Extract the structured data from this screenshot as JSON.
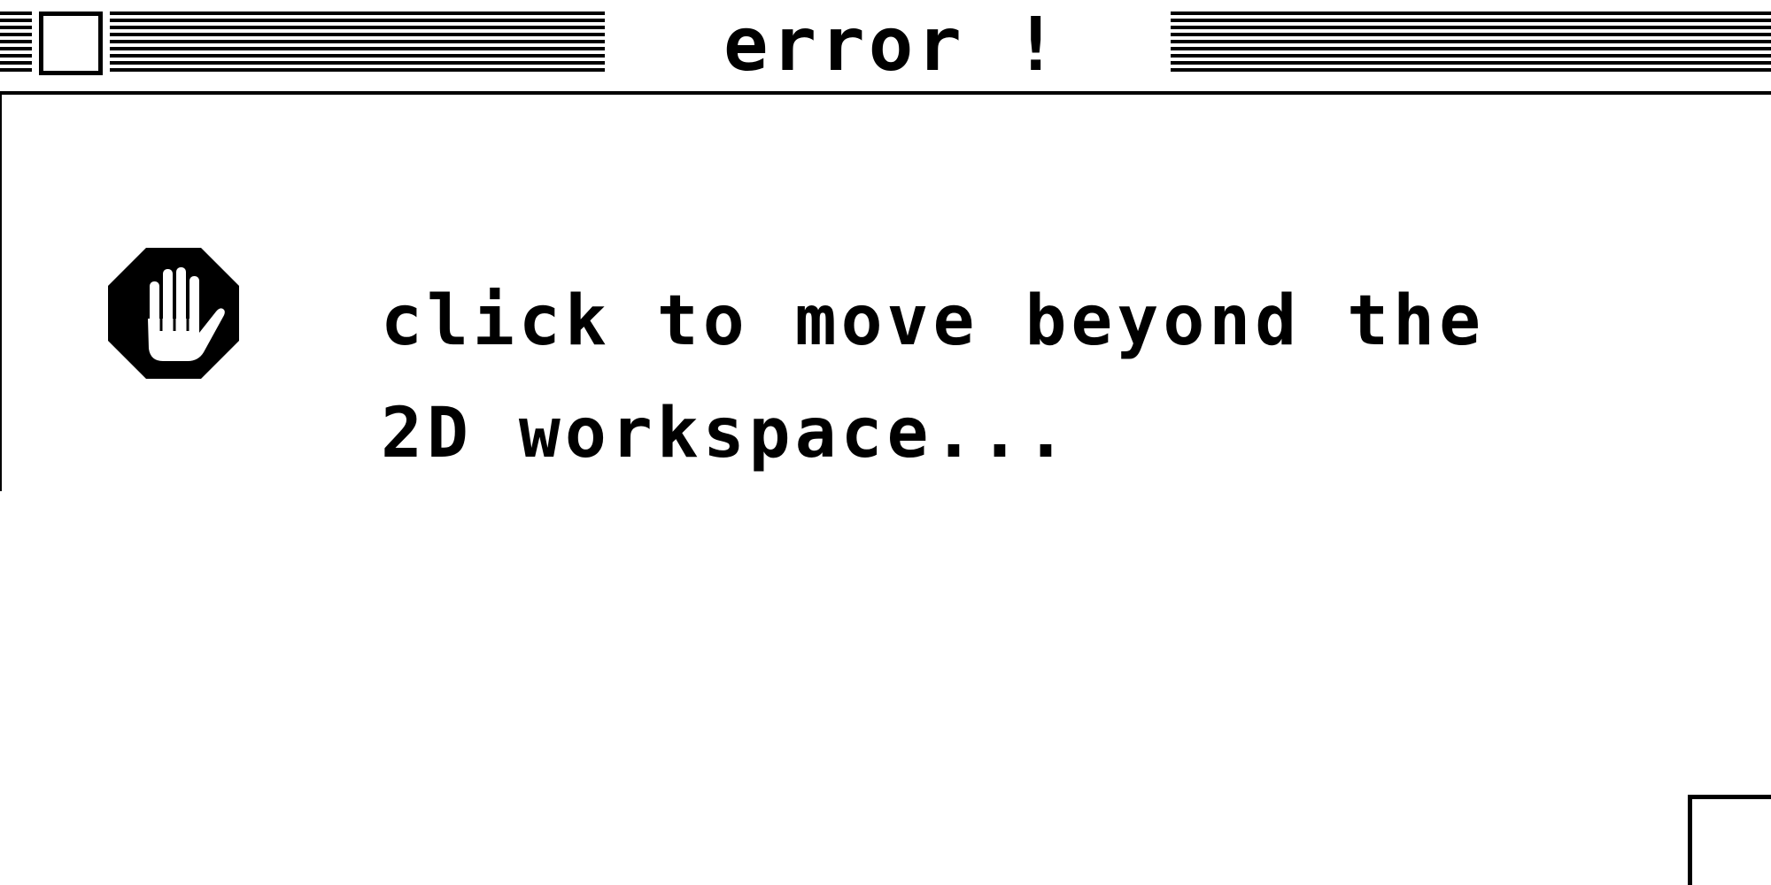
{
  "window": {
    "title": "error !"
  },
  "dialog": {
    "icon": "stop-hand-icon",
    "message": "click to move beyond the 2D workspace..."
  },
  "colors": {
    "foreground": "#000000",
    "background": "#ffffff"
  }
}
